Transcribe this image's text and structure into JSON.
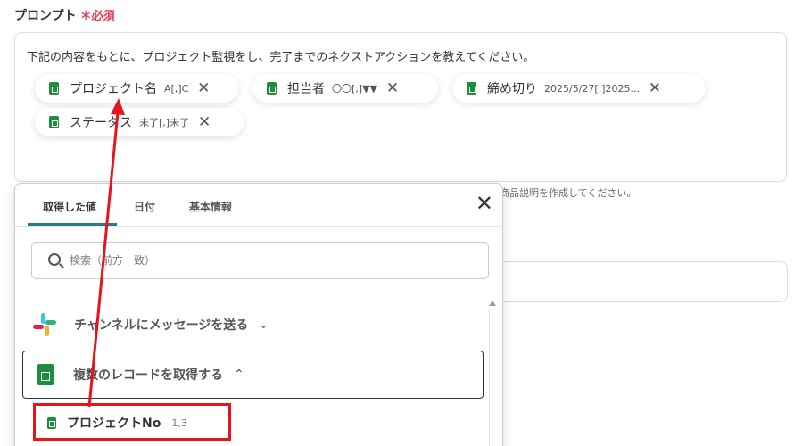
{
  "field": {
    "label": "プロンプト",
    "required_mark": "＊",
    "required_text": "必須"
  },
  "prompt": {
    "text": "下記の内容をもとに、プロジェクト監視をし、完了までのネクストアクションを教えてください。",
    "chips": [
      {
        "label": "プロジェクト名",
        "value": "A[,]C",
        "icon": "sheets-icon"
      },
      {
        "label": "担当者",
        "value": "〇〇[,]▼▼",
        "icon": "sheets-icon"
      },
      {
        "label": "締め切り",
        "value": "2025/5/27[,]2025...",
        "icon": "sheets-icon"
      },
      {
        "label": "ステータス",
        "value": "未了[,]未了",
        "icon": "sheets-icon"
      }
    ]
  },
  "hint_text": "商品説明を作成してください。",
  "popup": {
    "tabs": [
      "取得した値",
      "日付",
      "基本情報"
    ],
    "active_tab": 0,
    "search_placeholder": "検索（前方一致）",
    "groups": [
      {
        "title": "チャンネルにメッセージを送る",
        "icon": "slack-icon",
        "expanded": false
      },
      {
        "title": "複数のレコードを取得する",
        "icon": "sheets-icon",
        "expanded": true
      }
    ],
    "item": {
      "label": "プロジェクトNo",
      "value": "1,3",
      "icon": "sheets-icon"
    }
  },
  "colors": {
    "accent": "#2a7a8c",
    "required": "#e5394f",
    "sheets_green": "#1e8e3e",
    "annotation_red": "#e8141c"
  }
}
